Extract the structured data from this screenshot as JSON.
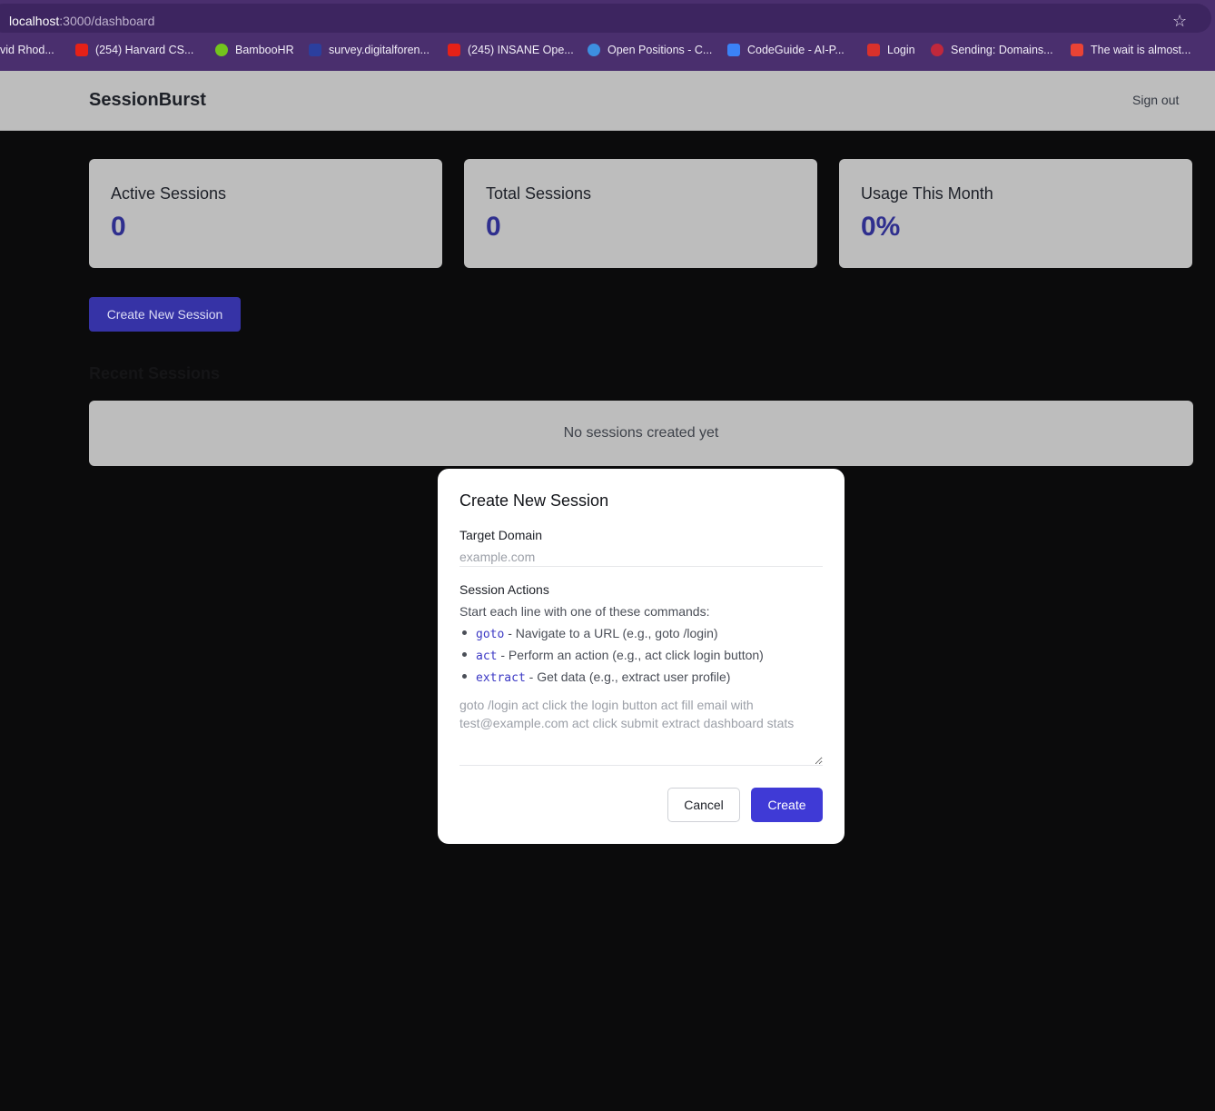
{
  "browser": {
    "url_host": "localhost",
    "url_path": ":3000/dashboard",
    "bookmarks": [
      {
        "label": "vid Rhod...",
        "color": ""
      },
      {
        "label": "(254) Harvard CS...",
        "color": "#e62117"
      },
      {
        "label": "BambooHR",
        "color": "#73c41d"
      },
      {
        "label": "survey.digitalforen...",
        "color": "#2b3f9e"
      },
      {
        "label": "(245) INSANE Ope...",
        "color": "#e62117"
      },
      {
        "label": "Open Positions - C...",
        "color": "#3d8fe0"
      },
      {
        "label": "CodeGuide - AI-P...",
        "color": "#3b82f6"
      },
      {
        "label": "Login",
        "color": "#d9312b"
      },
      {
        "label": "Sending: Domains...",
        "color": "#c0283c"
      },
      {
        "label": "The wait is almost...",
        "color": "#ea4335"
      }
    ]
  },
  "header": {
    "brand": "SessionBurst",
    "signout": "Sign out"
  },
  "stats": [
    {
      "label": "Active Sessions",
      "value": "0"
    },
    {
      "label": "Total Sessions",
      "value": "0"
    },
    {
      "label": "Usage This Month",
      "value": "0%"
    }
  ],
  "create_button": "Create New Session",
  "recent": {
    "title": "Recent Sessions",
    "empty": "No sessions created yet"
  },
  "modal": {
    "title": "Create New Session",
    "domain_label": "Target Domain",
    "domain_placeholder": "example.com",
    "actions_label": "Session Actions",
    "help": "Start each line with one of these commands:",
    "commands": [
      {
        "cmd": "goto",
        "desc": " - Navigate to a URL (e.g., goto /login)"
      },
      {
        "cmd": "act",
        "desc": " - Perform an action (e.g., act click login button)"
      },
      {
        "cmd": "extract",
        "desc": " - Get data (e.g., extract user profile)"
      }
    ],
    "actions_placeholder": "goto /login act click the login button act fill email with test@example.com act click submit extract dashboard stats",
    "cancel": "Cancel",
    "create": "Create"
  }
}
